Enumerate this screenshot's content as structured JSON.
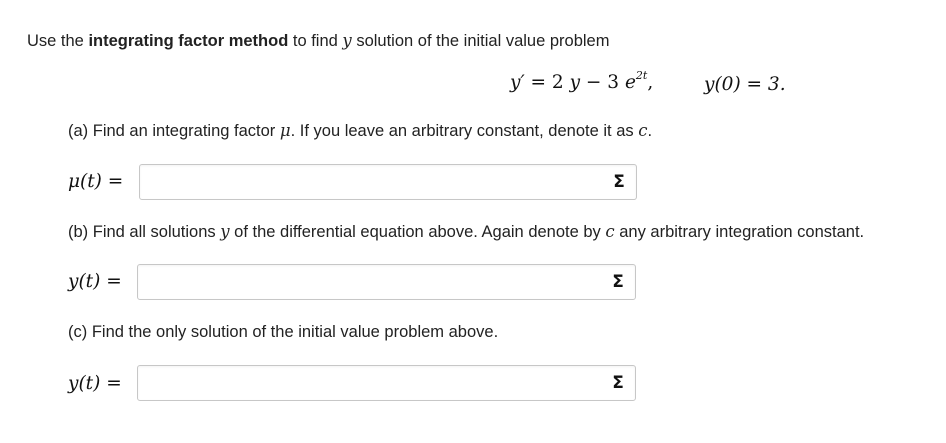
{
  "intro": {
    "prefix": "Use the ",
    "bold": "integrating factor method",
    "middle": " to find ",
    "var": "y",
    "suffix": " solution of the initial value problem"
  },
  "equation": {
    "lhs": "y′",
    "eq": " = 2 ",
    "y": "y",
    "minus": " − 3 ",
    "e": "e",
    "exp": "2t",
    "comma": ",",
    "ic": "y(0) = 3."
  },
  "parts": {
    "a": {
      "text1": "(a) Find an integrating factor ",
      "mu": "μ",
      "text2": ". If you leave an arbitrary constant, denote it as ",
      "c": "c",
      "text3": ".",
      "label": "μ(t) =",
      "value": "",
      "button_icon": "sigma-icon",
      "button_label": "Σ"
    },
    "b": {
      "text1": "(b) Find all solutions ",
      "y": "y",
      "text2": " of the differential equation above. Again denote by ",
      "c": "c",
      "text3": " any arbitrary integration constant.",
      "label": "y(t) =",
      "value": "",
      "button_icon": "sigma-icon",
      "button_label": "Σ"
    },
    "c": {
      "text1": "(c) Find the only solution of the initial value problem above.",
      "label": "y(t) =",
      "value": "",
      "button_icon": "sigma-icon",
      "button_label": "Σ"
    }
  }
}
